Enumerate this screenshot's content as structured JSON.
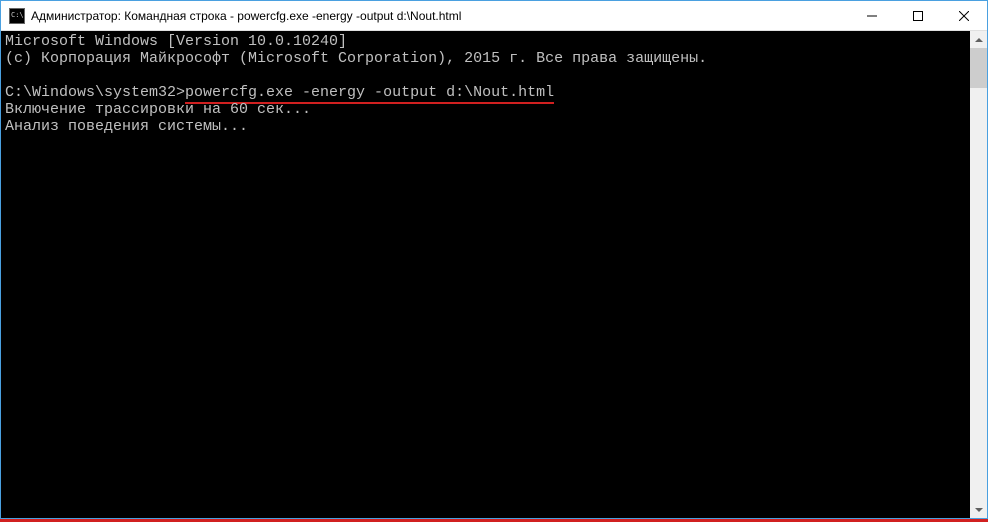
{
  "titlebar": {
    "title": "Администратор: Командная строка - powercfg.exe  -energy -output d:\\Nout.html"
  },
  "terminal": {
    "line1": "Microsoft Windows [Version 10.0.10240]",
    "line2": "(c) Корпорация Майкрософт (Microsoft Corporation), 2015 г. Все права защищены.",
    "blank1": "",
    "prompt_prefix": "C:\\Windows\\system32>",
    "command": "powercfg.exe -energy -output d:\\Nout.html",
    "line4": "Включение трассировки на 60 сек...",
    "line5": "Анализ поведения системы..."
  }
}
